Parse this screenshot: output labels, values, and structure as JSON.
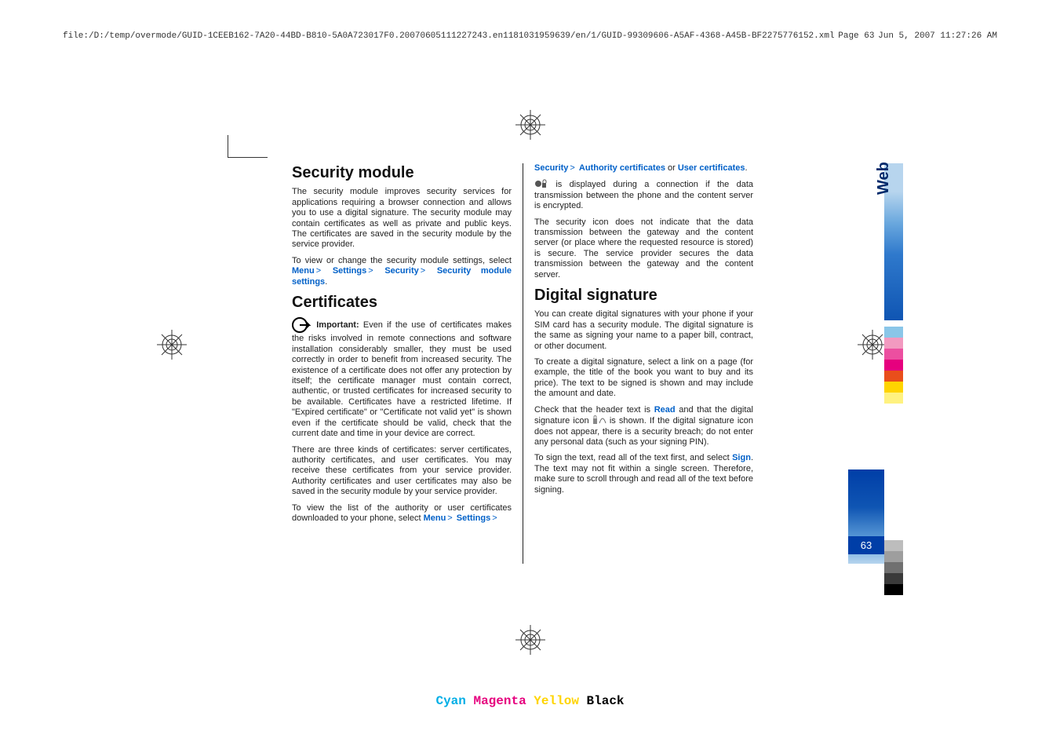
{
  "header": {
    "path": "file:/D:/temp/overmode/GUID-1CEEB162-7A20-44BD-B810-5A0A723017F0.20070605111227243.en1181031959639/en/1/GUID-99309606-A5AF-4368-A45B-BF2275776152.xml",
    "page_label": "Page  63",
    "timestamp": "Jun 5, 2007 11:27:26 AM"
  },
  "side": {
    "tab": "Web",
    "page_number": "63"
  },
  "col1": {
    "h1": "Security module",
    "p1": "The security module improves security services for applications requiring a browser connection and allows you to use a digital signature. The security module may contain certificates as well as private and public keys. The certificates are saved in the security module by the service provider.",
    "p2a": "To view or change the security module settings, select ",
    "menu": "Menu",
    "settings": "Settings",
    "security": "Security",
    "sms": "Security module settings",
    "h2": "Certificates",
    "imp_label": "Important:",
    "imp_text": "  Even if the use of certificates makes the risks involved in remote connections and software installation considerably smaller, they must be used correctly in order to benefit from increased security. The existence of a certificate does not offer any protection by itself; the certificate manager must contain correct, authentic, or trusted certificates for increased security to be available. Certificates have a restricted lifetime. If \"Expired certificate\" or \"Certificate not valid yet\" is shown even if the certificate should be valid, check that the current date and time in your device are correct.",
    "p4": "There are three kinds of certificates: server certificates, authority certificates, and user certificates. You may receive these certificates from your service provider. Authority certificates and user certificates may also be saved in the security module by your service provider.",
    "p5a": "To view the list of the authority or user certificates downloaded to your phone, select "
  },
  "col2": {
    "top_sec": "Security",
    "top_auth": "Authority certificates",
    "top_or": " or ",
    "top_user": "User certificates",
    "p1a": " is displayed during a connection if the data transmission between the phone and the content server is encrypted.",
    "p2": "The security icon does not indicate that the data transmission between the gateway and the content server (or place where the requested resource is stored) is secure. The service provider secures the data transmission between the gateway and the content server.",
    "h1": "Digital signature",
    "p3": "You can create digital signatures with your phone if your SIM card has a security module. The digital signature is the same as signing your name to a paper bill, contract, or other document.",
    "p4": "To create a digital signature, select a link on a page (for example, the title of the book you want to buy and its price). The text to be signed is shown and may include the amount and date.",
    "p5a": "Check that the header text is ",
    "read": "Read",
    "p5b": " and that the digital signature icon ",
    "p5c": " is shown. If the digital signature icon does not appear, there is a security breach; do not enter any personal data (such as your signing PIN).",
    "p6a": "To sign the text, read all of the text first, and select ",
    "sign": "Sign",
    "p6b": ". The text may not fit within a single screen. Therefore, make sure to scroll through and read all of the text before signing."
  },
  "footer": {
    "c": "Cyan",
    "m": "Magenta",
    "y": "Yellow",
    "k": "Black"
  }
}
